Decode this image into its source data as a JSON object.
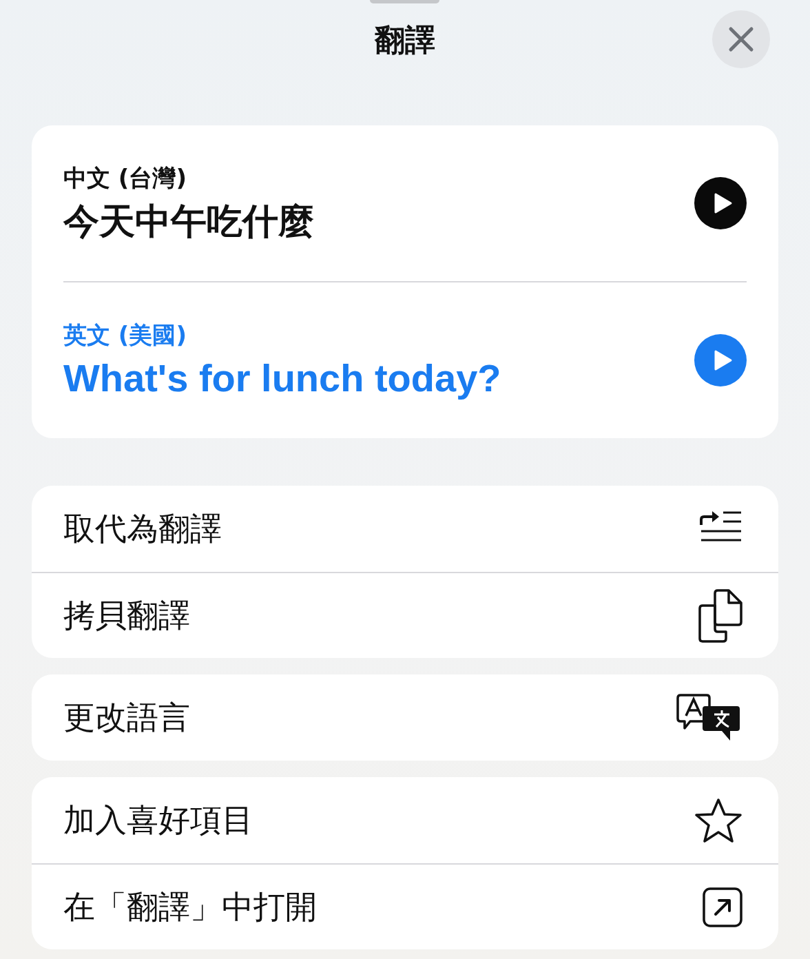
{
  "title": "翻譯",
  "translations": [
    {
      "kind": "source",
      "language": "中文 (台灣)",
      "text": "今天中午吃什麼"
    },
    {
      "kind": "target",
      "language": "英文 (美國)",
      "text": "What's for lunch today?"
    }
  ],
  "action_groups": [
    [
      {
        "label": "取代為翻譯"
      },
      {
        "label": "拷貝翻譯"
      }
    ],
    [
      {
        "label": "更改語言"
      }
    ],
    [
      {
        "label": "加入喜好項目"
      },
      {
        "label": "在「翻譯」中打開"
      }
    ]
  ]
}
